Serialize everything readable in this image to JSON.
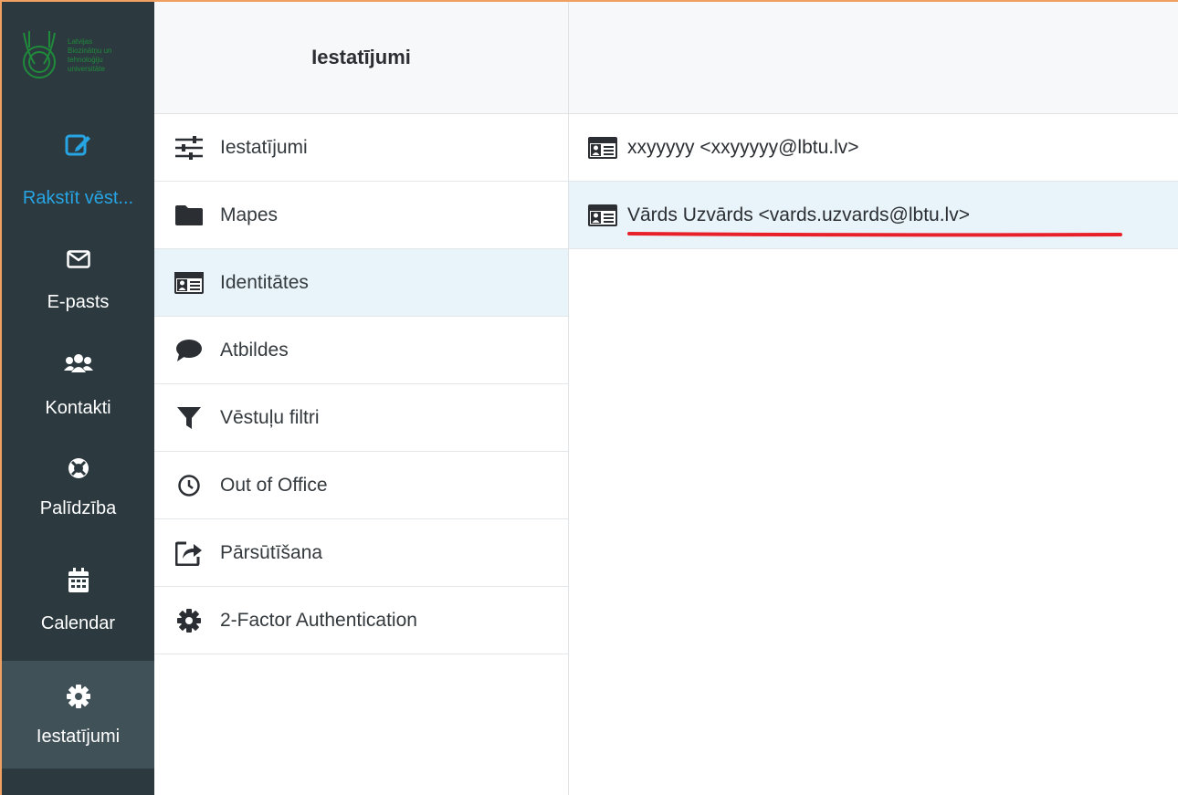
{
  "colors": {
    "nav_bg": "#2c3a40",
    "nav_active_bg": "#415158",
    "compose_accent": "#27a4e3",
    "selected_row_bg": "#e8f4fa",
    "logo_green": "#1f8a3a",
    "annotation_red": "#e8202a"
  },
  "logo": {
    "lines": [
      "Latvijas",
      "Biozinātņu un",
      "tehnoloģiju",
      "universitāte"
    ]
  },
  "nav": [
    {
      "id": "compose",
      "label": "Rakstīt vēst...",
      "icon": "compose-icon"
    },
    {
      "id": "mail",
      "label": "E-pasts",
      "icon": "envelope-icon"
    },
    {
      "id": "contacts",
      "label": "Kontakti",
      "icon": "users-icon"
    },
    {
      "id": "help",
      "label": "Palīdzība",
      "icon": "lifebuoy-icon"
    },
    {
      "id": "calendar",
      "label": "Calendar",
      "icon": "calendar-icon"
    },
    {
      "id": "settings",
      "label": "Iestatījumi",
      "icon": "gear-icon"
    }
  ],
  "settings_panel": {
    "title": "Iestatījumi",
    "items": [
      {
        "label": "Iestatījumi",
        "icon": "sliders-icon"
      },
      {
        "label": "Mapes",
        "icon": "folder-icon"
      },
      {
        "label": "Identitātes",
        "icon": "id-card-icon"
      },
      {
        "label": "Atbildes",
        "icon": "comment-icon"
      },
      {
        "label": "Vēstuļu filtri",
        "icon": "filter-icon"
      },
      {
        "label": "Out of Office",
        "icon": "clock-icon"
      },
      {
        "label": "Pārsūtīšana",
        "icon": "share-icon"
      },
      {
        "label": "2-Factor Authentication",
        "icon": "gear-icon"
      }
    ],
    "selected_index": 2
  },
  "identities": {
    "items": [
      {
        "label": "xxyyyyy <xxyyyyy@lbtu.lv>",
        "icon": "id-card-icon"
      },
      {
        "label": "Vārds Uzvārds <vards.uzvards@lbtu.lv>",
        "icon": "id-card-icon"
      }
    ],
    "selected_index": 1
  }
}
